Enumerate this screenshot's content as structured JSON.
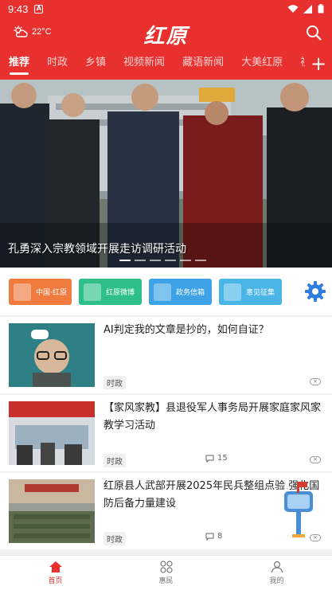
{
  "status": {
    "time": "9:43",
    "badge": "A"
  },
  "header": {
    "temperature": "22°C",
    "logo": "红原",
    "weather_icon": "cloud-sun-icon"
  },
  "tabs": [
    {
      "label": "推荐",
      "active": true
    },
    {
      "label": "时政",
      "active": false
    },
    {
      "label": "乡镇",
      "active": false
    },
    {
      "label": "视频新闻",
      "active": false
    },
    {
      "label": "藏语新闻",
      "active": false
    },
    {
      "label": "大美红原",
      "active": false
    },
    {
      "label": "视",
      "active": false
    }
  ],
  "banner": {
    "caption": "孔勇深入宗教领域开展走访调研活动",
    "slide_count": 6,
    "active_slide": 1
  },
  "quick_links": [
    {
      "label": "中国·红原",
      "color": "#f07b3f"
    },
    {
      "label": "红原微博",
      "color": "#2fc08a"
    },
    {
      "label": "政务信箱",
      "color": "#3da3e6"
    },
    {
      "label": "意见征集",
      "color": "#4ab6e8"
    }
  ],
  "feed": [
    {
      "title": "AI判定我的文章是抄的，如何自证？",
      "tag": "时政",
      "comments": ""
    },
    {
      "title": "【家风家教】县退役军人事务局开展家庭家风家教学习活动",
      "tag": "时政",
      "comments": "15"
    },
    {
      "title": "红原县人武部开展2025年民兵整组点验 强化国防后备力量建设",
      "tag": "时政",
      "comments": "8"
    }
  ],
  "bottom_nav": [
    {
      "label": "首页",
      "active": true
    },
    {
      "label": "惠民",
      "active": false
    },
    {
      "label": "我的",
      "active": false
    }
  ],
  "colors": {
    "brand": "#e8312f"
  }
}
